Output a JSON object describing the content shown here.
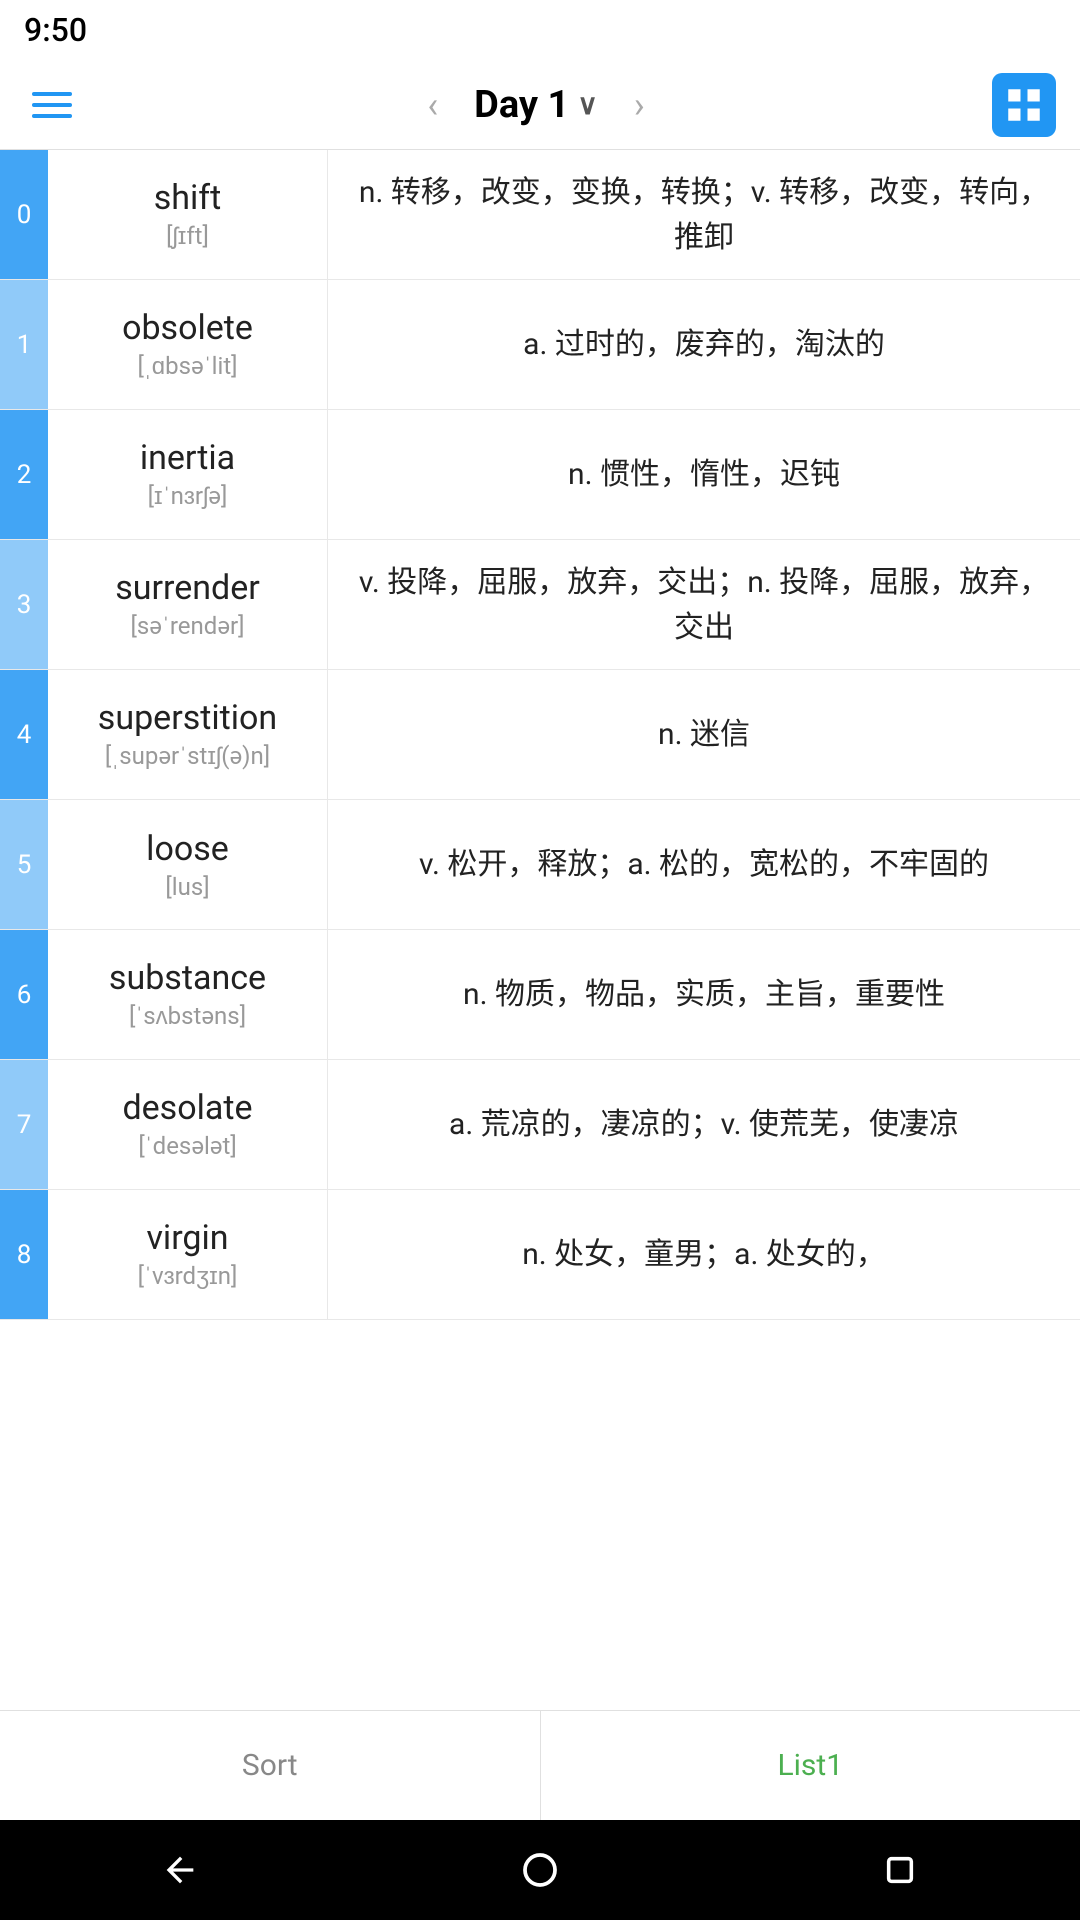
{
  "statusBar": {
    "time": "9:50"
  },
  "topNav": {
    "title": "Day 1",
    "prevArrow": "‹",
    "nextArrow": "›"
  },
  "words": [
    {
      "index": "0",
      "english": "shift",
      "phonetic": "[ʃɪft]",
      "definition": "n. 转移，改变，变换，转换；v. 转移，改变，转向，推卸"
    },
    {
      "index": "1",
      "english": "obsolete",
      "phonetic": "[ˌɑbsəˈlit]",
      "definition": "a. 过时的，废弃的，淘汰的"
    },
    {
      "index": "2",
      "english": "inertia",
      "phonetic": "[ɪˈnɜrʃə]",
      "definition": "n. 惯性，惰性，迟钝"
    },
    {
      "index": "3",
      "english": "surrender",
      "phonetic": "[səˈrendər]",
      "definition": "v. 投降，屈服，放弃，交出；n. 投降，屈服，放弃，交出"
    },
    {
      "index": "4",
      "english": "superstition",
      "phonetic": "[ˌsupərˈstɪʃ(ə)n]",
      "definition": "n. 迷信"
    },
    {
      "index": "5",
      "english": "loose",
      "phonetic": "[lus]",
      "definition": "v. 松开，释放；a. 松的，宽松的，不牢固的"
    },
    {
      "index": "6",
      "english": "substance",
      "phonetic": "[ˈsʌbstəns]",
      "definition": "n. 物质，物品，实质，主旨，重要性"
    },
    {
      "index": "7",
      "english": "desolate",
      "phonetic": "[ˈdesələt]",
      "definition": "a. 荒凉的，凄凉的；v. 使荒芜，使凄凉"
    },
    {
      "index": "8",
      "english": "virgin",
      "phonetic": "[ˈvɜrdʒɪn]",
      "definition": "n. 处女，童男；a. 处女的，"
    }
  ],
  "bottomTabs": [
    {
      "label": "Sort",
      "active": false
    },
    {
      "label": "List1",
      "active": true
    }
  ]
}
